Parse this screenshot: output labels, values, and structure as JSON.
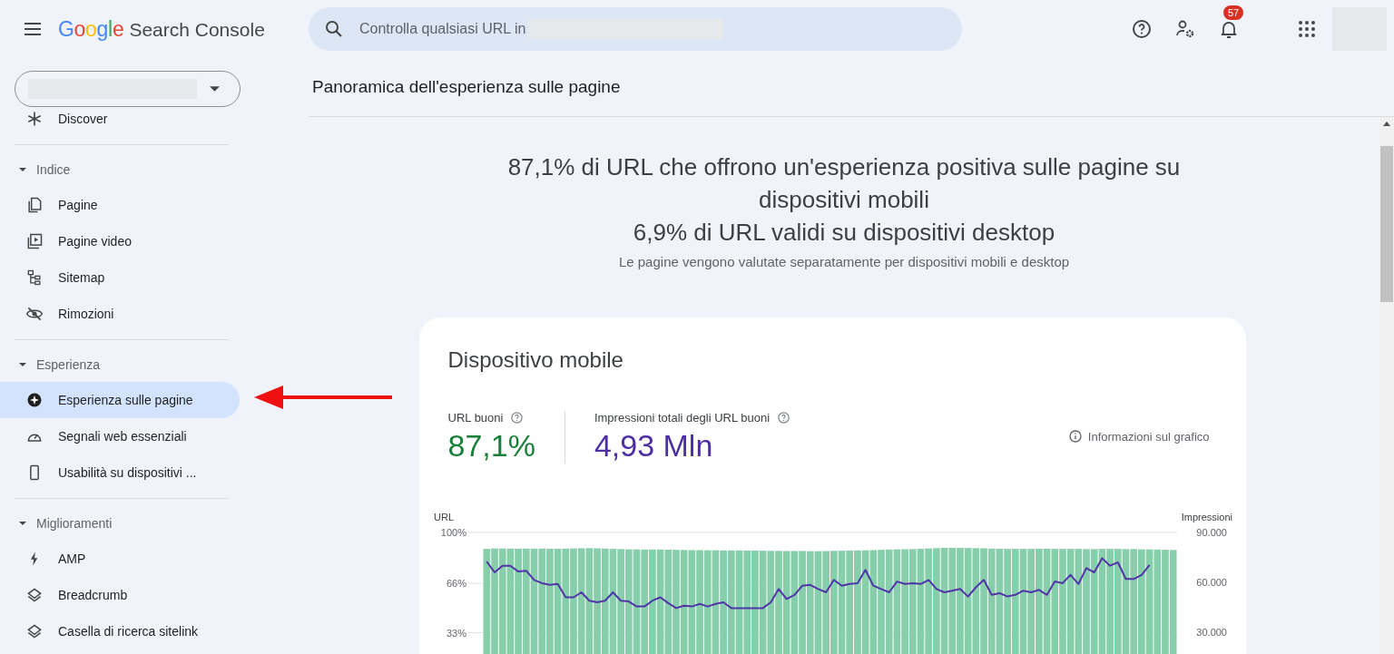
{
  "header": {
    "logo": "Google",
    "app_name": "Search Console",
    "search": {
      "placeholder": "Controlla qualsiasi URL in"
    },
    "notifications": {
      "count": "57"
    }
  },
  "sidebar": {
    "sections": [
      {
        "items": [
          {
            "label": "Discover",
            "selected": false
          }
        ]
      },
      {
        "title": "Indice",
        "expanded": true,
        "items": [
          {
            "label": "Pagine",
            "selected": false
          },
          {
            "label": "Pagine video",
            "selected": false
          },
          {
            "label": "Sitemap",
            "selected": false
          },
          {
            "label": "Rimozioni",
            "selected": false
          }
        ]
      },
      {
        "title": "Esperienza",
        "expanded": true,
        "items": [
          {
            "label": "Esperienza sulle pagine",
            "selected": true
          },
          {
            "label": "Segnali web essenziali",
            "selected": false
          },
          {
            "label": "Usabilità su dispositivi ...",
            "selected": false
          }
        ]
      },
      {
        "title": "Miglioramenti",
        "expanded": true,
        "items": [
          {
            "label": "AMP",
            "selected": false
          },
          {
            "label": "Breadcrumb",
            "selected": false
          },
          {
            "label": "Casella di ricerca sitelink",
            "selected": false
          }
        ]
      }
    ]
  },
  "main": {
    "title": "Panoramica dell'esperienza sulle pagine",
    "headline": [
      "87,1% di URL che offrono un'esperienza positiva sulle pagine su dispositivi mobili",
      "6,9% di URL validi su dispositivi desktop"
    ],
    "subtitle": "Le pagine vengono valutate separatamente per dispositivi mobili e desktop",
    "card": {
      "title": "Dispositivo mobile",
      "metrics": [
        {
          "label": "URL buoni",
          "value": "87,1%",
          "color": "#188038"
        },
        {
          "label": "Impressioni totali degli URL buoni",
          "value": "4,93 Mln",
          "color": "#4e2fa3"
        }
      ],
      "info_link": "Informazioni sul grafico",
      "url_chart": {
        "chart_data": {
          "type": "bar",
          "ylabel": "URL",
          "ylim": [
            0,
            100
          ],
          "yticks": [
            {
              "value": 100,
              "label": "100%"
            },
            {
              "value": 66,
              "label": "66%"
            },
            {
              "value": 33,
              "label": "33%"
            }
          ],
          "series": [
            {
              "color": "#87ceab",
              "values": [
                89,
                89.3,
                89.3,
                89.2,
                89.1,
                89.2,
                89.2,
                89.2,
                89.1,
                89.1,
                89.2,
                89.3,
                89.4,
                89.5,
                89.4,
                89.2,
                89,
                88.9,
                88.7,
                88.7,
                88.6,
                88.6,
                88.6,
                88.5,
                88.4,
                88.3,
                88.2,
                88.2,
                88.1,
                88.1,
                88,
                88,
                88,
                87.9,
                87.9,
                87.8,
                87.7,
                87.7,
                87.6,
                87.6,
                87.6,
                87.5,
                87.5,
                87.6,
                87.7,
                87.8,
                87.9,
                88,
                88.1,
                88.2,
                88.4,
                88.6,
                88.7,
                88.8,
                88.9,
                89.1,
                89.3,
                89.5,
                89.7,
                89.7,
                89.7,
                89.6,
                89.5,
                89.4,
                89.2,
                89.1,
                89,
                89,
                89,
                89,
                89.1,
                89.1,
                89,
                89,
                89,
                89,
                88.9,
                88.9,
                89,
                89,
                89,
                88.9,
                88.9,
                88.7,
                88.7,
                88.6,
                88.4,
                88.3
              ]
            }
          ]
        }
      },
      "impressions_chart": {
        "chart_data": {
          "type": "line",
          "ylabel": "Impressioni",
          "ylim": [
            30000,
            90000
          ],
          "yticks": [
            {
              "value": 90000,
              "label": "90.000"
            },
            {
              "value": 60000,
              "label": "60.000"
            },
            {
              "value": 30000,
              "label": "30.000"
            }
          ],
          "series": [
            {
              "color": "#5035a8",
              "values": [
                72500,
                66000,
                70000,
                70000,
                66500,
                67000,
                61500,
                59500,
                58500,
                59000,
                51000,
                51000,
                54000,
                49000,
                48000,
                49000,
                54000,
                49000,
                48500,
                45500,
                45500,
                49000,
                51000,
                47500,
                44500,
                46000,
                45500,
                47000,
                45500,
                47000,
                48000,
                44500,
                44500,
                44500,
                44500,
                44500,
                48000,
                56000,
                50000,
                52500,
                58000,
                58500,
                56000,
                54000,
                61500,
                58000,
                59000,
                59500,
                67500,
                58000,
                56000,
                54000,
                60500,
                59000,
                59500,
                59000,
                61500,
                56000,
                54000,
                55000,
                56000,
                51500,
                57000,
                61500,
                52500,
                53500,
                51500,
                52500,
                55000,
                54000,
                55500,
                52500,
                60500,
                59500,
                64500,
                59000,
                68500,
                66000,
                74500,
                70000,
                72000,
                62000,
                62000,
                64500,
                70500,
                null,
                null,
                null
              ]
            }
          ]
        }
      }
    }
  }
}
